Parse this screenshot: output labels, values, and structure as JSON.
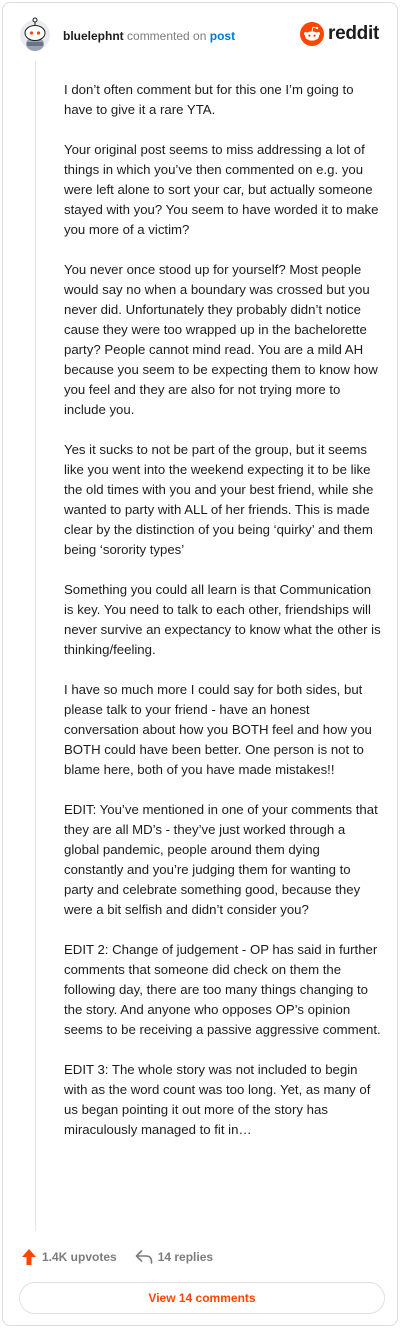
{
  "header": {
    "username": "bluelephnt",
    "commented_on": "commented on",
    "post_link": "post",
    "logo_text": "reddit"
  },
  "comment": {
    "paragraphs": [
      "I don’t often comment but for this one I’m going to have to give it a rare YTA.",
      "Your original post seems to miss addressing a lot of things in which you’ve then commented on e.g. you were left alone to sort your car, but actually someone stayed with you? You seem to have worded it to make you more of a victim?",
      "You never once stood up for yourself? Most people would say no when a boundary was crossed but you never did. Unfortunately they probably didn’t notice cause they were too wrapped up in the bachelorette party? People cannot mind read. You are a mild AH because you seem to be expecting them to know how you feel and they are also for not trying more to include you.",
      "Yes it sucks to not be part of the group, but it seems like you went into the weekend expecting it to be like the old times with you and your best friend, while she wanted to party with ALL of her friends. This is made clear by the distinction of you being ‘quirky’ and them being ‘sorority types’",
      "Something you could all learn is that Communication is key. You need to talk to each other, friendships will never survive an expectancy to know what the other is thinking/feeling.",
      "I have so much more I could say for both sides, but please talk to your friend - have an honest conversation about how you BOTH feel and how you BOTH could have been better. One person is not to blame here, both of you have made mistakes!!",
      "EDIT: You’ve mentioned in one of your comments that they are all MD’s - they’ve just worked through a global pandemic, people around them dying constantly and you’re judging them for wanting to party and celebrate something good, because they were a bit selfish and didn’t consider you?",
      "EDIT 2: Change of judgement - OP has said in further comments that someone did check on them the following day, there are too many things changing to the story. And anyone who opposes OP’s opinion seems to be receiving a passive aggressive comment.",
      "EDIT 3: The whole story was not included to begin with as the word count was too long. Yet, as many of us began pointing it out more of the story has miraculously managed to fit in…"
    ]
  },
  "actions": {
    "upvotes": "1.4K upvotes",
    "replies": "14 replies",
    "view_comments": "View 14 comments"
  },
  "icons": {
    "avatar": "snoo-avatar-icon",
    "logo": "reddit-logo-icon",
    "upvote": "upvote-arrow-icon",
    "reply": "reply-arrow-icon"
  },
  "colors": {
    "accent": "#ff4500",
    "link": "#0079d3",
    "muted": "#7c7c7c"
  }
}
